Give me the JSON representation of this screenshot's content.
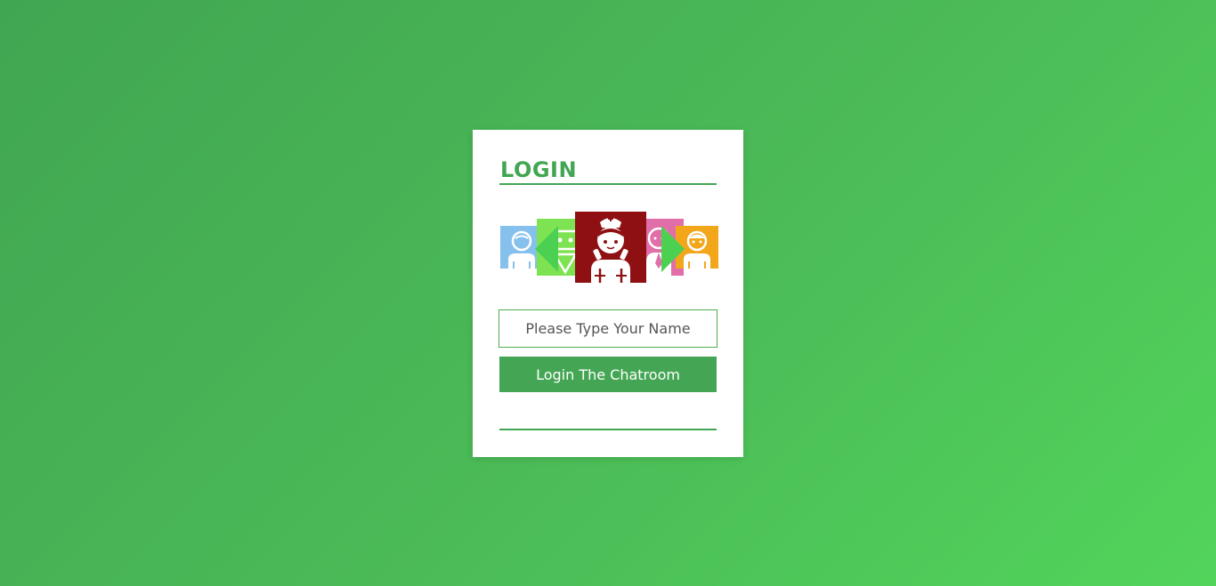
{
  "login": {
    "title": "LOGIN",
    "name_placeholder": "Please Type Your Name",
    "name_value": "",
    "submit_label": "Login The Chatroom"
  },
  "avatar_carousel": {
    "selected_index": 2,
    "avatars": [
      {
        "name": "boy-avatar",
        "color": "#86c1ee"
      },
      {
        "name": "robot-avatar",
        "color": "#7ee352"
      },
      {
        "name": "nurse-avatar",
        "color": "#8f1012"
      },
      {
        "name": "businesswoman-avatar",
        "color": "#e16ea8"
      },
      {
        "name": "girl-avatar",
        "color": "#f2a71b"
      }
    ],
    "prev_icon": "triangle-left-icon",
    "next_icon": "triangle-right-icon",
    "arrow_color": "#4bd052"
  },
  "colors": {
    "accent": "#42a653",
    "card_background": "#ffffff"
  }
}
